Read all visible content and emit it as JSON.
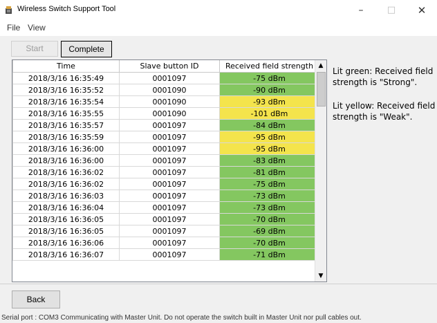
{
  "window": {
    "title": "Wireless Switch Support Tool",
    "min_glyph": "–",
    "max_glyph": "□",
    "close_glyph": "✕"
  },
  "menu": {
    "items": [
      "File",
      "View"
    ]
  },
  "toolbar": {
    "start_label": "Start",
    "complete_label": "Complete"
  },
  "table": {
    "headers": [
      "Time",
      "Slave button ID",
      "Received field strength"
    ],
    "rows": [
      {
        "time": "2018/3/16 16:35:49",
        "id": "0001097",
        "strength": "-75 dBm",
        "level": "strong"
      },
      {
        "time": "2018/3/16 16:35:52",
        "id": "0001090",
        "strength": "-90 dBm",
        "level": "strong"
      },
      {
        "time": "2018/3/16 16:35:54",
        "id": "0001090",
        "strength": "-93 dBm",
        "level": "weak"
      },
      {
        "time": "2018/3/16 16:35:55",
        "id": "0001090",
        "strength": "-101 dBm",
        "level": "weak"
      },
      {
        "time": "2018/3/16 16:35:57",
        "id": "0001097",
        "strength": "-84 dBm",
        "level": "strong"
      },
      {
        "time": "2018/3/16 16:35:59",
        "id": "0001097",
        "strength": "-95 dBm",
        "level": "weak"
      },
      {
        "time": "2018/3/16 16:36:00",
        "id": "0001097",
        "strength": "-95 dBm",
        "level": "weak"
      },
      {
        "time": "2018/3/16 16:36:00",
        "id": "0001097",
        "strength": "-83 dBm",
        "level": "strong"
      },
      {
        "time": "2018/3/16 16:36:02",
        "id": "0001097",
        "strength": "-81 dBm",
        "level": "strong"
      },
      {
        "time": "2018/3/16 16:36:02",
        "id": "0001097",
        "strength": "-75 dBm",
        "level": "strong"
      },
      {
        "time": "2018/3/16 16:36:03",
        "id": "0001097",
        "strength": "-73 dBm",
        "level": "strong"
      },
      {
        "time": "2018/3/16 16:36:04",
        "id": "0001097",
        "strength": "-73 dBm",
        "level": "strong"
      },
      {
        "time": "2018/3/16 16:36:05",
        "id": "0001097",
        "strength": "-70 dBm",
        "level": "strong"
      },
      {
        "time": "2018/3/16 16:36:05",
        "id": "0001097",
        "strength": "-69 dBm",
        "level": "strong"
      },
      {
        "time": "2018/3/16 16:36:06",
        "id": "0001097",
        "strength": "-70 dBm",
        "level": "strong"
      },
      {
        "time": "2018/3/16 16:36:07",
        "id": "0001097",
        "strength": "-71 dBm",
        "level": "strong"
      }
    ],
    "colors": {
      "strong": "#84c760",
      "weak": "#f4e44c"
    }
  },
  "legend": {
    "green": "Lit green: Received field strength is \"Strong\".",
    "yellow": "Lit yellow: Received field strength is \"Weak\"."
  },
  "footer": {
    "back_label": "Back",
    "status": "Serial port :   COM3   Communicating with Master Unit. Do not operate the switch built in Master Unit nor pull cables out."
  }
}
